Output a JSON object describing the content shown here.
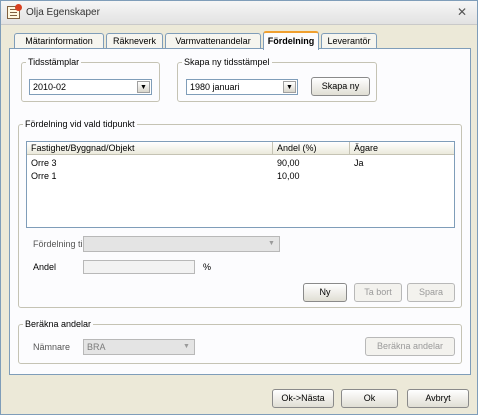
{
  "window": {
    "title": "Olja Egenskaper",
    "close_glyph": "✕"
  },
  "tabs": [
    {
      "label": "Mätarinformation"
    },
    {
      "label": "Räkneverk"
    },
    {
      "label": "Varmvattenandelar"
    },
    {
      "label": "Fördelning"
    },
    {
      "label": "Leverantör"
    }
  ],
  "tidsstamplar": {
    "legend": "Tidsstämplar",
    "selected": "2010-02"
  },
  "skapa": {
    "legend": "Skapa ny tidsstämpel",
    "selected": "1980 januari",
    "button": "Skapa ny"
  },
  "fordelning": {
    "legend": "Fördelning vid vald tidpunkt",
    "columns": [
      "Fastighet/Byggnad/Objekt",
      "Andel (%)",
      "Ägare"
    ],
    "rows": [
      {
        "object": "Orre 3",
        "share": "90,00",
        "owner": "Ja"
      },
      {
        "object": "Orre 1",
        "share": "10,00",
        "owner": ""
      }
    ],
    "fordelning_till_label": "Fördelning till",
    "fordelning_till_value": "",
    "andel_label": "Andel",
    "andel_value": "",
    "percent_sign": "%",
    "buttons": {
      "ny": "Ny",
      "ta_bort": "Ta bort",
      "spara": "Spara"
    }
  },
  "berakna": {
    "legend": "Beräkna andelar",
    "namnare_label": "Nämnare",
    "namnare_value": "BRA",
    "button": "Beräkna andelar"
  },
  "footer": {
    "ok_nasta": "Ok->Nästa",
    "ok": "Ok",
    "avbryt": "Avbryt"
  },
  "icons": {
    "dropdown": "▼"
  }
}
